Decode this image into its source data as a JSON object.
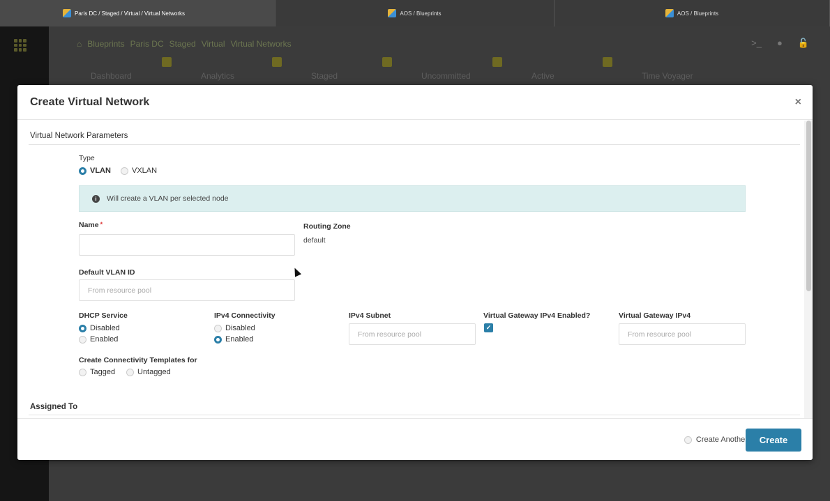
{
  "browser_tabs": [
    {
      "label": "Paris DC / Staged / Virtual / Virtual Networks",
      "active": true
    },
    {
      "label": "AOS / Blueprints",
      "active": false
    },
    {
      "label": "AOS / Blueprints",
      "active": false
    }
  ],
  "background": {
    "breadcrumb": [
      "Blueprints",
      "Paris DC",
      "Staged",
      "Virtual",
      "Virtual Networks"
    ],
    "nav_tabs": [
      "Dashboard",
      "Analytics",
      "Staged",
      "Uncommitted",
      "Active",
      "Time Voyager"
    ]
  },
  "modal": {
    "title": "Create Virtual Network",
    "close_icon": "×",
    "section_params": "Virtual Network Parameters",
    "type": {
      "label": "Type",
      "options": [
        "VLAN",
        "VXLAN"
      ],
      "selected": "VLAN"
    },
    "info_message": "Will create a VLAN per selected node",
    "name": {
      "label": "Name",
      "required_mark": "*",
      "value": ""
    },
    "routing_zone": {
      "label": "Routing Zone",
      "value": "default"
    },
    "default_vlan_id": {
      "label": "Default VLAN ID",
      "placeholder": "From resource pool"
    },
    "dhcp_service": {
      "label": "DHCP Service",
      "options": [
        "Disabled",
        "Enabled"
      ],
      "selected": "Disabled"
    },
    "ipv4_connectivity": {
      "label": "IPv4 Connectivity",
      "options": [
        "Disabled",
        "Enabled"
      ],
      "selected": "Enabled"
    },
    "ipv4_subnet": {
      "label": "IPv4 Subnet",
      "placeholder": "From resource pool"
    },
    "vgw_ipv4_enabled": {
      "label": "Virtual Gateway IPv4 Enabled?",
      "checked": true
    },
    "vgw_ipv4": {
      "label": "Virtual Gateway IPv4",
      "placeholder": "From resource pool"
    },
    "conn_templates": {
      "label": "Create Connectivity Templates for",
      "options": [
        "Tagged",
        "Untagged"
      ]
    },
    "section_assigned": "Assigned To",
    "footer": {
      "create_another_label": "Create Another?",
      "create_label": "Create"
    }
  },
  "colors": {
    "accent": "#2b7fa8",
    "info_bg": "#dcefef"
  }
}
